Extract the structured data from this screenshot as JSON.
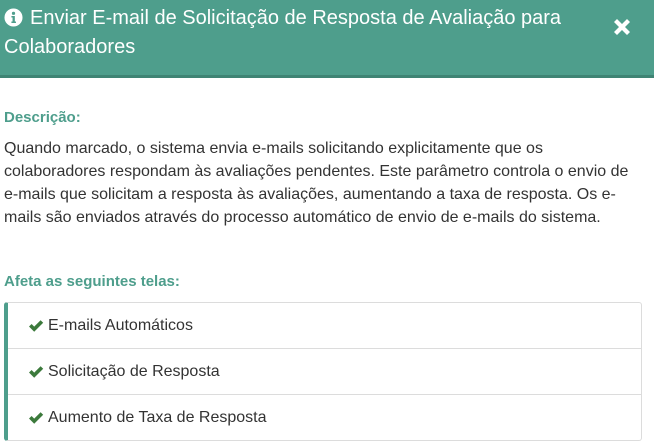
{
  "header": {
    "title": "Enviar E-mail de Solicitação de Resposta de Avaliação para Colaboradores",
    "icon": "info-circle-icon",
    "close_icon": "close-icon",
    "background_color": "#4e9e8c"
  },
  "description": {
    "label": "Descrição:",
    "text": "Quando marcado, o sistema envia e-mails solicitando explicitamente que os colaboradores respondam às avaliações pendentes. Este parâmetro controla o envio de e-mails que solicitam a resposta às avaliações, aumentando a taxa de resposta. Os e-mails são enviados através do processo automático de envio de e-mails do sistema."
  },
  "affects": {
    "label": "Afeta as seguintes telas:",
    "items": [
      {
        "label": "E-mails Automáticos",
        "icon": "check-icon"
      },
      {
        "label": "Solicitação de Resposta",
        "icon": "check-icon"
      },
      {
        "label": "Aumento de Taxa de Resposta",
        "icon": "check-icon"
      }
    ],
    "accent_color": "#4e9e8c",
    "check_color": "#3c7a3c"
  }
}
